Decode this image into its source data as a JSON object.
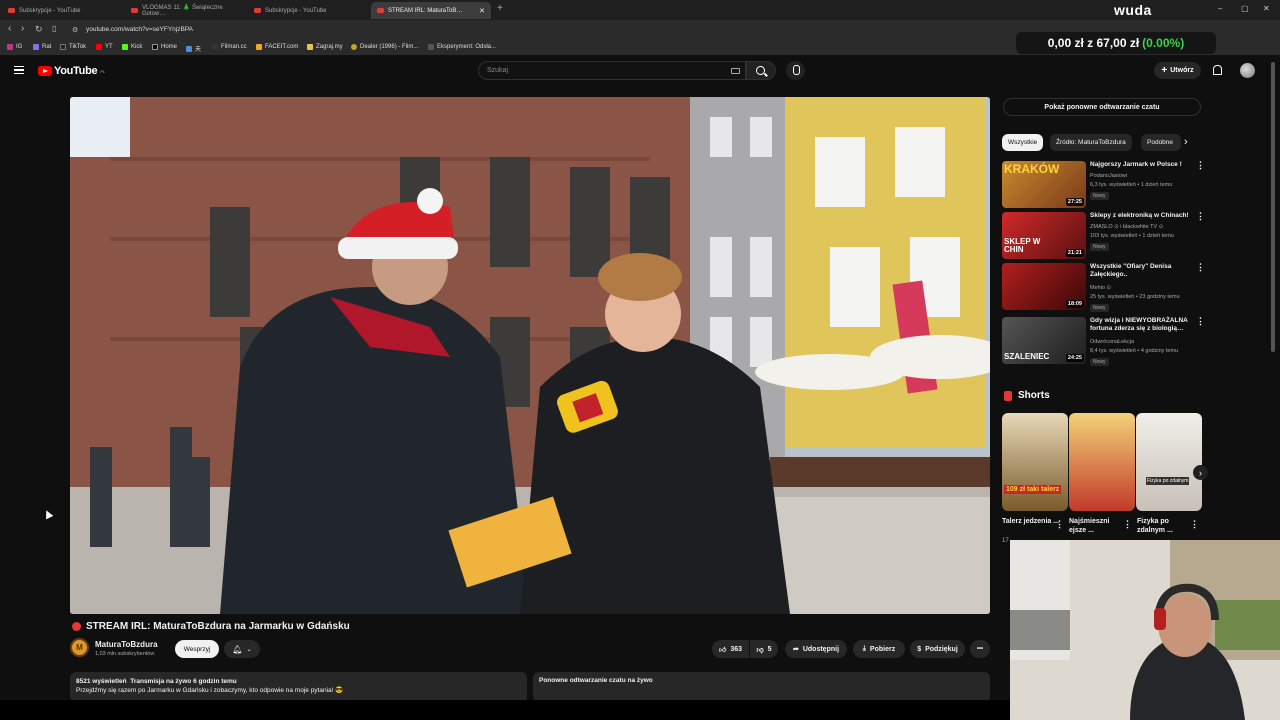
{
  "browser": {
    "tabs": [
      {
        "label": "Subskrypcje - YouTube",
        "active": false
      },
      {
        "label": "VLOGMAS 11: 🎄 Świąteczne Gotow…",
        "active": false
      },
      {
        "label": "Subskrypcje - YouTube",
        "active": false
      },
      {
        "label": "STREAM IRL: MaturaToB…",
        "active": true
      }
    ],
    "new_tab": "+",
    "url": "youtube.com/watch?v=seYFYnjzBPA",
    "bookmarks": [
      "IG",
      "Rat",
      "TikTok",
      "YT",
      "Kick",
      "Home",
      "天",
      "Filman.cc",
      "FACEIT.com",
      "Zagraj.my",
      "Dealer (1996) - Film...",
      "Eksperyment: Odsła..."
    ],
    "window_controls": {
      "minimize": "–",
      "maximize": "▢",
      "close": "✕"
    }
  },
  "overlay": {
    "streamer_name": "wuda",
    "money": "0,00 zł z 67,00 zł",
    "money_pct": "(0.00%)",
    "pct_color": "#3ad14a"
  },
  "header": {
    "logo_text": "YouTube",
    "region": "PL",
    "search_placeholder": "Szukaj",
    "create_label": "Utwórz"
  },
  "video": {
    "title": "STREAM IRL: MaturaToBzdura na Jarmarku w Gdańsku",
    "channel": "MaturaToBzdura",
    "channel_initial": "M",
    "subscribers": "1,03 mln subskrybentów",
    "support_label": "Wesprzyj",
    "likes": "363",
    "dislikes": "5",
    "share_label": "Udostępnij",
    "download_label": "Pobierz",
    "thanks_label": "Podziękuj",
    "more": "•••"
  },
  "description": {
    "views": "8521 wyświetleń",
    "time": "Transmisja na żywo 6 godzin temu",
    "text": "Przejdźmy się razem po Jarmarku w Gdańsku i zobaczymy, kto odpowie na moje pytania! 😎"
  },
  "chat_replay": {
    "title": "Ponowne odtwarzanie czatu na żywo",
    "show_button": "Pokaż ponowne odtwarzanie czatu"
  },
  "sidebar": {
    "chips": [
      {
        "label": "Wszystkie",
        "active": true
      },
      {
        "label": "Źródło: MaturaToBzdura",
        "active": false
      },
      {
        "label": "Podobne",
        "active": false
      }
    ],
    "recommendations": [
      {
        "title": "Najgorszy Jarmark w Polsce !",
        "channel": "PodanoJasiowi",
        "meta": "6,3 tys. wyświetleń • 1 dzień temu",
        "badge": "Nowy",
        "duration": "27:25",
        "thumb_text": "KRAKÓW"
      },
      {
        "title": "Sklepy z elektroniką w Chinach!",
        "channel": "ZMASLO ⊙ i blackwhite TV ⊙",
        "meta": "103 tys. wyświetleń • 1 dzień temu",
        "badge": "Nowy",
        "duration": "21:21",
        "thumb_text": "SKLEP W CHIN"
      },
      {
        "title": "Wszystkie \"Ofiary\" Denisa Załęckiego..",
        "channel": "Mehio ⊙",
        "meta": "25 tys. wyświetleń • 23 godziny temu",
        "badge": "Nowy",
        "duration": "18:09",
        "thumb_text": ""
      },
      {
        "title": "Gdy wizja i NIEWYOBRAŻALNA fortuna zderza się z biologią…",
        "channel": "OdwróconaLekcja",
        "meta": "8,4 tys. wyświetleń • 4 godziny temu",
        "badge": "Nowy",
        "duration": "24:25",
        "thumb_text": "SZALENIEC"
      }
    ],
    "shorts_title": "Shorts",
    "shorts": [
      {
        "title": "Talerz jedzenia ...",
        "meta": "17",
        "overlay": "109 zł taki talerz"
      },
      {
        "title": "Najśmieszni ejsze ...",
        "meta": "",
        "overlay": ""
      },
      {
        "title": "Fizyka po zdalnym ...",
        "meta": "",
        "overlay": "Fizyka po zdalnym"
      }
    ]
  }
}
